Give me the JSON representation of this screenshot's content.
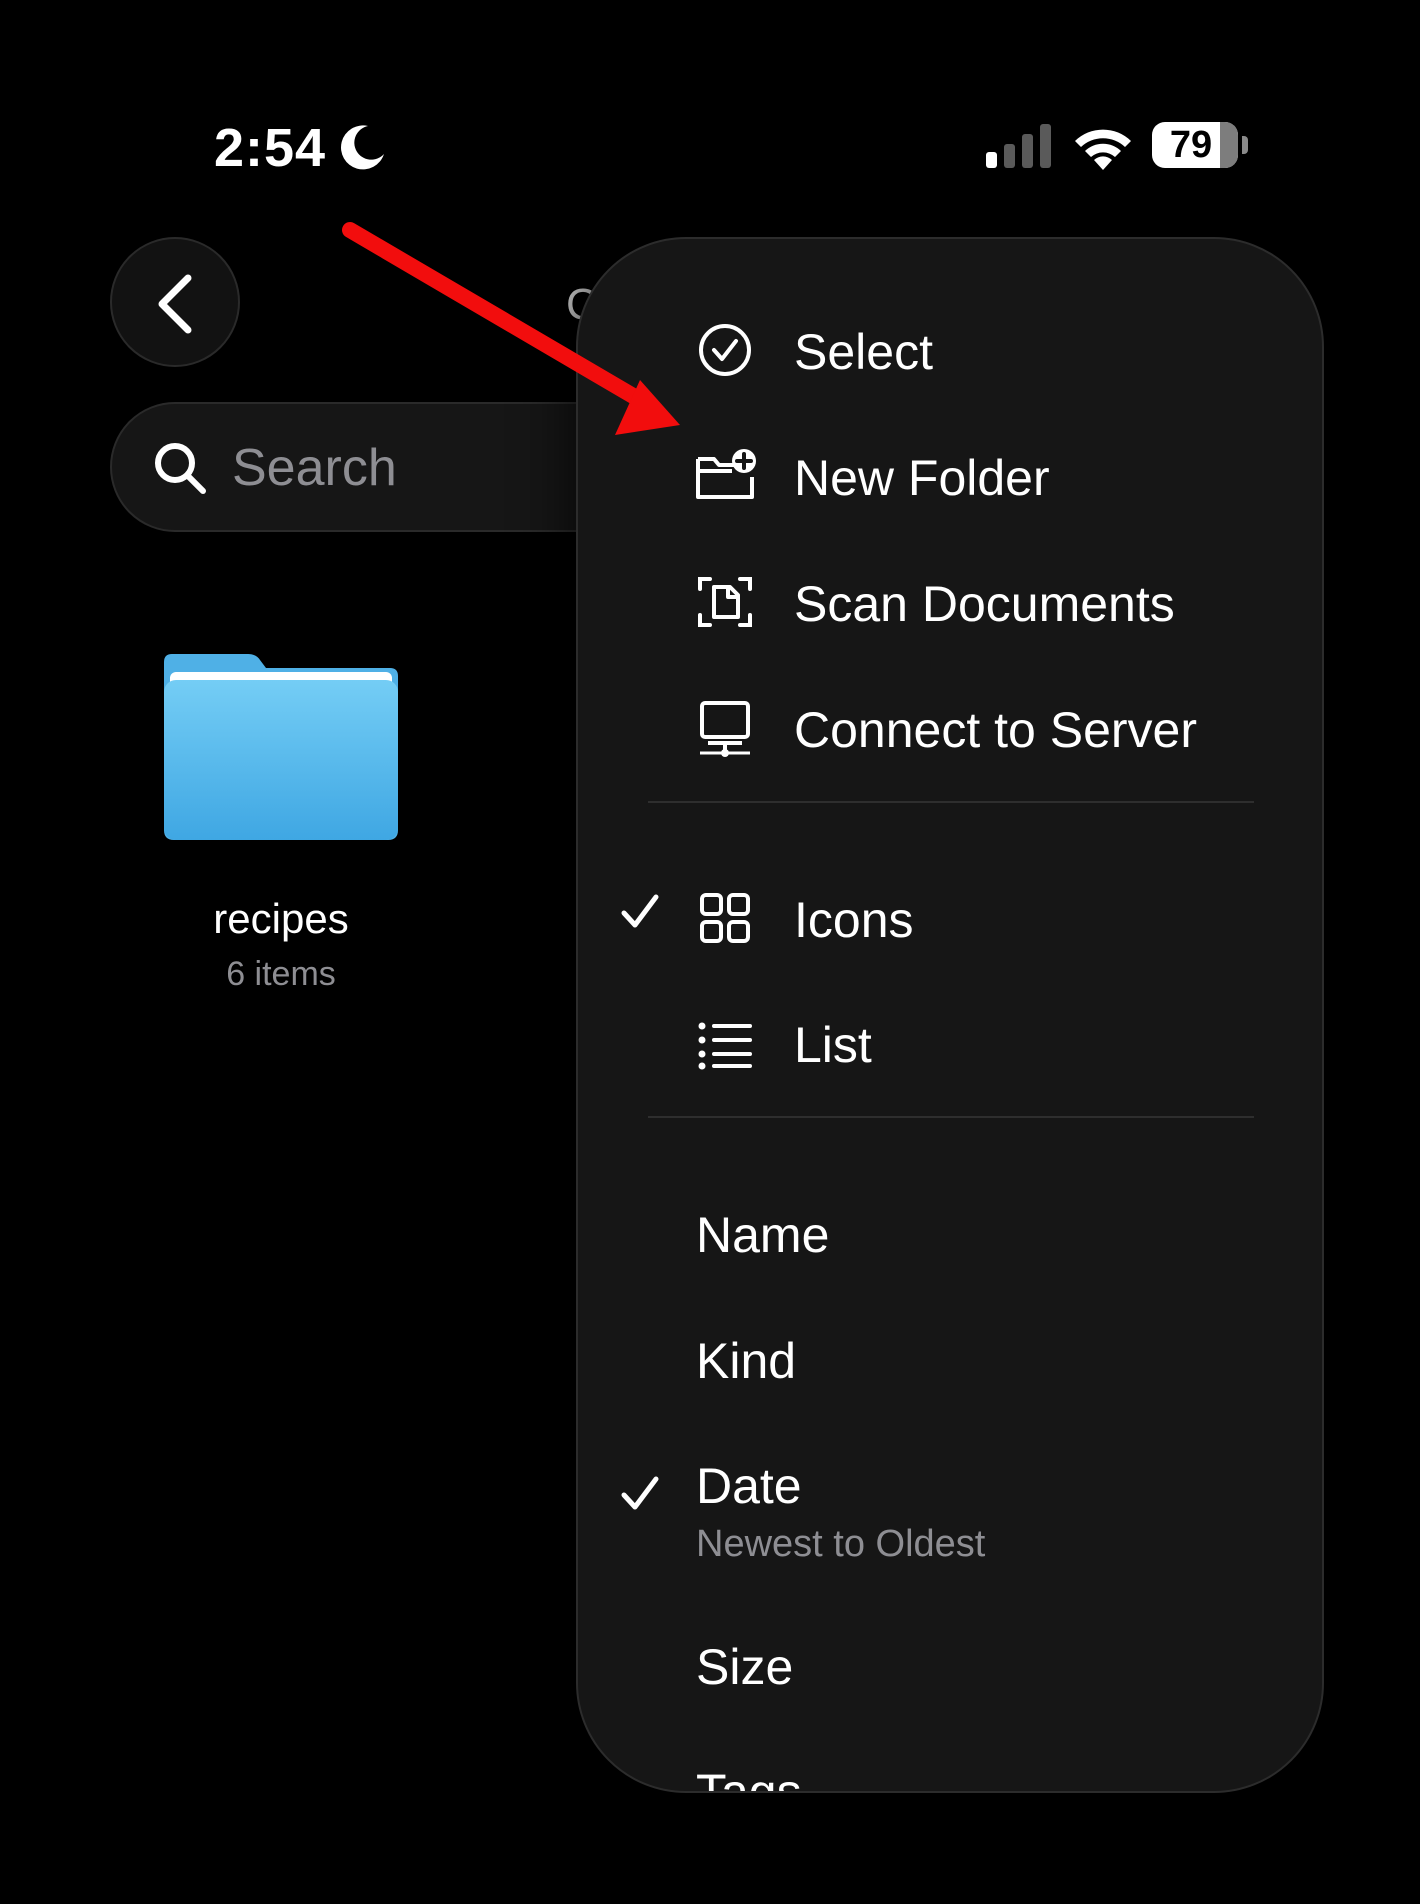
{
  "status_bar": {
    "time": "2:54",
    "battery_percent": "79",
    "battery_level": 0.79,
    "icons": [
      "moon-icon",
      "cellular-signal-icon",
      "wifi-icon",
      "battery-icon"
    ]
  },
  "nav": {
    "back_icon": "chevron-left-icon",
    "title_fragment": "C"
  },
  "search": {
    "placeholder": "Search",
    "value": ""
  },
  "folder": {
    "name": "recipes",
    "meta": "6 items",
    "color": "#5ec2f2"
  },
  "menu": {
    "actions": [
      {
        "label": "Select",
        "icon": "checkmark-circle-icon"
      },
      {
        "label": "New Folder",
        "icon": "folder-plus-icon"
      },
      {
        "label": "Scan Documents",
        "icon": "document-scan-icon"
      },
      {
        "label": "Connect to Server",
        "icon": "server-display-icon"
      }
    ],
    "views": [
      {
        "label": "Icons",
        "icon": "grid-icon",
        "checked": true
      },
      {
        "label": "List",
        "icon": "list-icon",
        "checked": false
      }
    ],
    "sort": [
      {
        "label": "Name",
        "checked": false
      },
      {
        "label": "Kind",
        "checked": false
      },
      {
        "label": "Date",
        "sublabel": "Newest to Oldest",
        "checked": true
      },
      {
        "label": "Size",
        "checked": false
      },
      {
        "label": "Tags",
        "checked": false
      }
    ]
  },
  "annotation": {
    "arrow_color": "#f20d0d"
  }
}
